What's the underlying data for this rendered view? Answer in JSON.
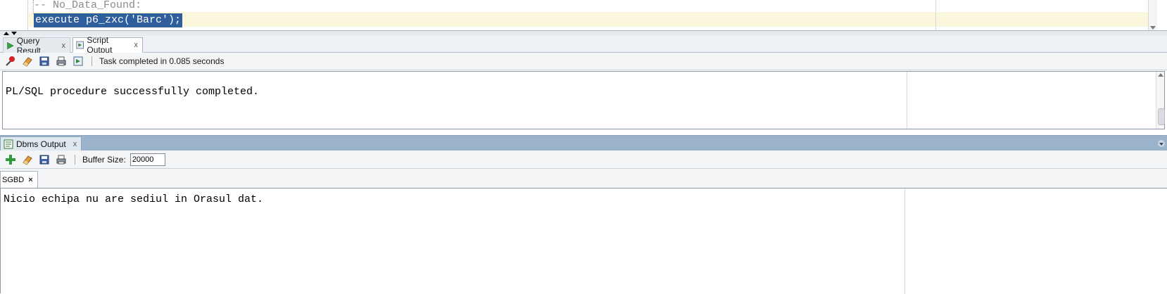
{
  "editor": {
    "line1": "-- No_Data_Found:",
    "line2": "execute p6_zxc('Barc');"
  },
  "tabs": [
    {
      "label": "Query Result",
      "close": "x",
      "icon": "play-icon"
    },
    {
      "label": "Script Output",
      "close": "x",
      "icon": "script-output-icon"
    }
  ],
  "script_toolbar": {
    "status": "Task completed in 0.085 seconds",
    "icons": [
      "pin-icon",
      "eraser-icon",
      "save-icon",
      "print-icon",
      "run-script-icon"
    ]
  },
  "script_output": {
    "text": "PL/SQL procedure successfully completed."
  },
  "dbms": {
    "tab_label": "Dbms Output",
    "close": "x",
    "buffer_label": "Buffer Size:",
    "buffer_value": "20000",
    "connection_tab": "SGBD",
    "connection_close": "×",
    "output_text": "Nicio echipa nu are sediul in Orasul dat."
  },
  "colors": {
    "selection": "#2f5e9c",
    "current_line": "#fbf7dc",
    "dbms_header": "#9bb3cb"
  }
}
